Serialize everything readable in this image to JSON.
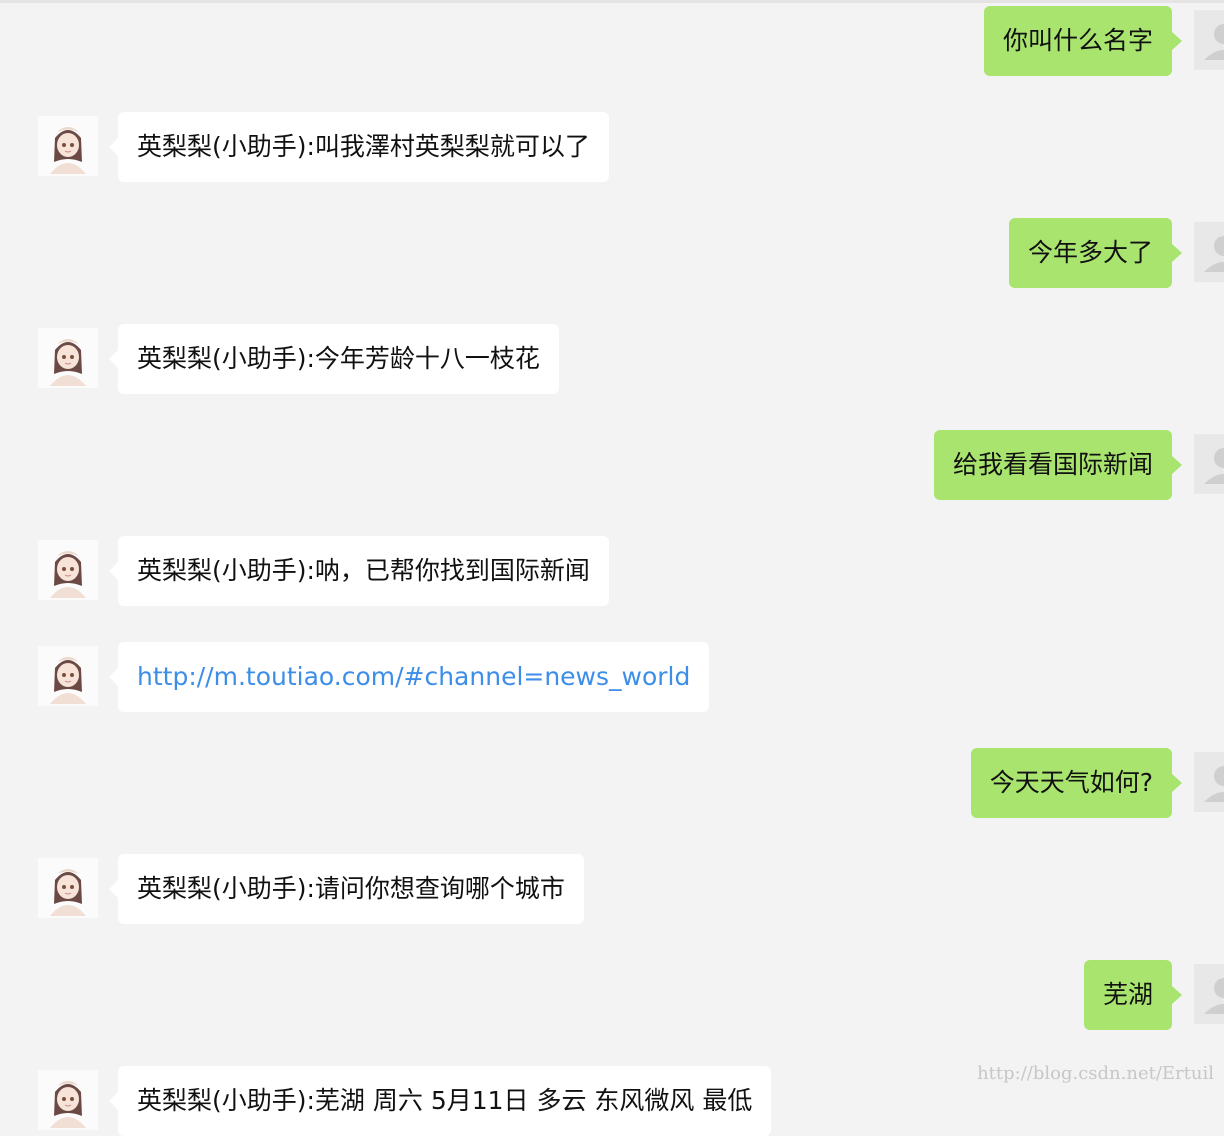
{
  "messages": [
    {
      "role": "user",
      "text": "你叫什么名字"
    },
    {
      "role": "bot",
      "text": "英梨梨(小助手):叫我澤村英梨梨就可以了"
    },
    {
      "role": "user",
      "text": "今年多大了"
    },
    {
      "role": "bot",
      "text": "英梨梨(小助手):今年芳龄十八一枝花"
    },
    {
      "role": "user",
      "text": "给我看看国际新闻"
    },
    {
      "role": "bot",
      "text": "英梨梨(小助手):呐，已帮你找到国际新闻"
    },
    {
      "role": "bot",
      "text": "http://m.toutiao.com/#channel=news_world",
      "is_link": true
    },
    {
      "role": "user",
      "text": "今天天气如何?"
    },
    {
      "role": "bot",
      "text": "英梨梨(小助手):请问你想查询哪个城市"
    },
    {
      "role": "user",
      "text": "芜湖"
    },
    {
      "role": "bot",
      "text": "英梨梨(小助手):芜湖 周六 5月11日 多云 东风微风 最低"
    }
  ],
  "watermark": "http://blog.csdn.net/Ertuil",
  "colors": {
    "user_bubble": "#a9e46f",
    "bot_bubble": "#ffffff",
    "link": "#3d8ee8",
    "background": "#f3f3f3"
  }
}
